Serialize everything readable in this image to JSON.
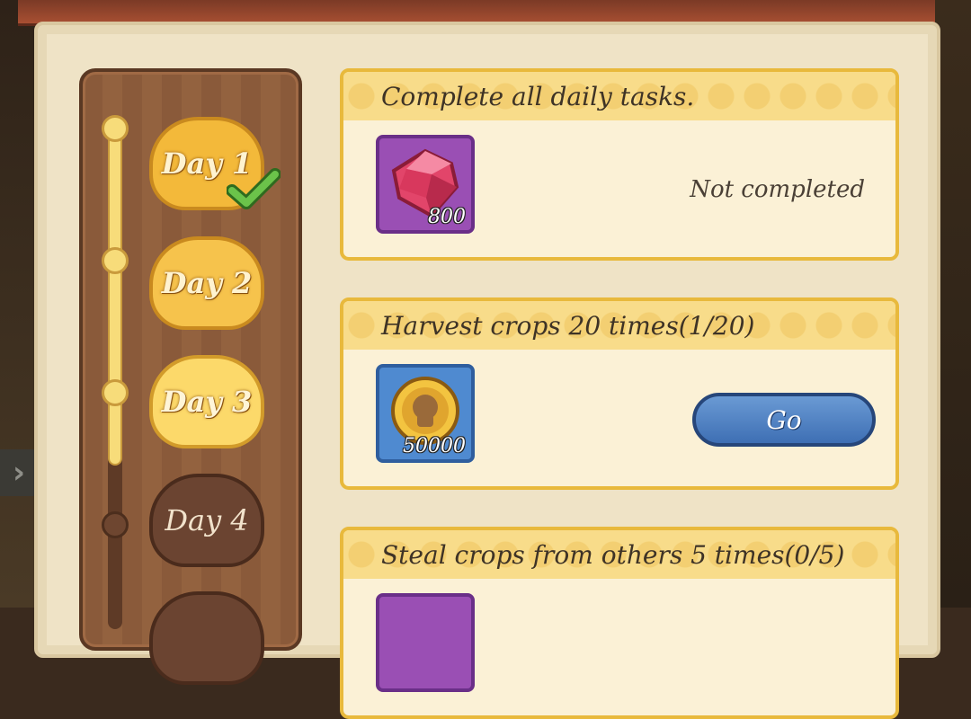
{
  "days": [
    {
      "label": "Day 1",
      "state": "completed"
    },
    {
      "label": "Day 2",
      "state": "available"
    },
    {
      "label": "Day 3",
      "state": "current"
    },
    {
      "label": "Day 4",
      "state": "locked"
    }
  ],
  "tasks": [
    {
      "title": "Complete all daily tasks.",
      "reward_icon": "gem-icon",
      "reward_qty": "800",
      "status": "Not completed"
    },
    {
      "title": "Harvest crops 20 times(1/20)",
      "reward_icon": "coin-icon",
      "reward_qty": "50000",
      "action": "Go"
    },
    {
      "title": "Steal crops from others 5 times(0/5)",
      "reward_icon": "gem-icon"
    }
  ],
  "colors": {
    "accent_gold": "#e8b93c",
    "button_blue": "#3e6fb4",
    "check_green": "#6bc34a"
  }
}
